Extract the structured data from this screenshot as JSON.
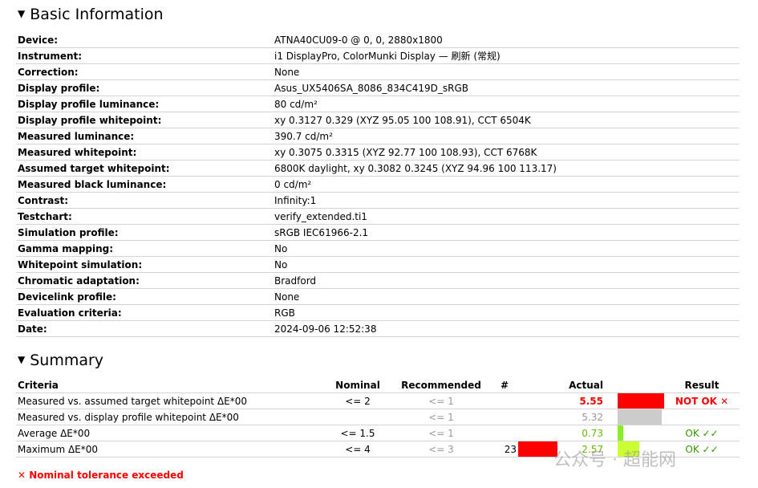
{
  "basic": {
    "title": "Basic Information",
    "rows": [
      {
        "label": "Device:",
        "value": "ATNA40CU09-0 @ 0, 0, 2880x1800"
      },
      {
        "label": "Instrument:",
        "value": "i1 DisplayPro, ColorMunki Display — 刷新 (常规)"
      },
      {
        "label": "Correction:",
        "value": "None"
      },
      {
        "label": "Display profile:",
        "value": "Asus_UX5406SA_8086_834C419D_sRGB"
      },
      {
        "label": "Display profile luminance:",
        "value": "80 cd/m²"
      },
      {
        "label": "Display profile whitepoint:",
        "value": "xy 0.3127 0.329 (XYZ 95.05 100 108.91), CCT 6504K"
      },
      {
        "label": "Measured luminance:",
        "value": "390.7 cd/m²"
      },
      {
        "label": "Measured whitepoint:",
        "value": "xy 0.3075 0.3315 (XYZ 92.77 100 108.93), CCT 6768K"
      },
      {
        "label": "Assumed target whitepoint:",
        "value": "6800K daylight, xy 0.3082 0.3245 (XYZ 94.96 100 113.17)"
      },
      {
        "label": "Measured black luminance:",
        "value": "0 cd/m²"
      },
      {
        "label": "Contrast:",
        "value": "Infinity:1"
      },
      {
        "label": "Testchart:",
        "value": "verify_extended.ti1"
      },
      {
        "label": "Simulation profile:",
        "value": "sRGB IEC61966-2.1"
      },
      {
        "label": "Gamma mapping:",
        "value": "No"
      },
      {
        "label": "Whitepoint simulation:",
        "value": "No"
      },
      {
        "label": "Chromatic adaptation:",
        "value": "Bradford"
      },
      {
        "label": "Devicelink profile:",
        "value": "None"
      },
      {
        "label": "Evaluation criteria:",
        "value": "RGB"
      },
      {
        "label": "Date:",
        "value": "2024-09-06 12:52:38"
      }
    ]
  },
  "summary": {
    "title": "Summary",
    "headers": {
      "criteria": "Criteria",
      "nominal": "Nominal",
      "recommended": "Recommended",
      "num": "#",
      "actual": "Actual",
      "result": "Result"
    },
    "rows": [
      {
        "criteria": "Measured vs. assumed target whitepoint ΔE*00",
        "nominal": "<= 2",
        "recommended": "<= 1",
        "num": "",
        "actual": "5.55",
        "actual_color": "#ff0000",
        "bar_color": "#ff0000",
        "bar_fraction": 1.0,
        "result": "NOT OK ✕",
        "result_color": "#ff0000"
      },
      {
        "criteria": "Measured vs. display profile whitepoint ΔE*00",
        "nominal": "",
        "recommended": "<= 1",
        "num": "",
        "actual": "5.32",
        "actual_color": "#999999",
        "bar_color": "#cccccc",
        "bar_fraction": 0.95,
        "result": "",
        "result_color": "#000000"
      },
      {
        "criteria": "Average ΔE*00",
        "nominal": "<= 1.5",
        "recommended": "<= 1",
        "num": "",
        "actual": "0.73",
        "actual_color": "#66bb00",
        "bar_color": "#88ee22",
        "bar_fraction": 0.12,
        "result": "OK ✓✓",
        "result_color": "#339900"
      },
      {
        "criteria": "Maximum ΔE*00",
        "nominal": "<= 4",
        "recommended": "<= 3",
        "num": "23",
        "num_bar_color": "#ff0000",
        "actual": "2.57",
        "actual_color": "#66bb00",
        "bar_color": "#ccff33",
        "bar_fraction": 0.47,
        "result": "OK ✓✓",
        "result_color": "#339900"
      }
    ],
    "footnote": "✕ Nominal tolerance exceeded"
  },
  "watermark": "公众号 · 超能网"
}
